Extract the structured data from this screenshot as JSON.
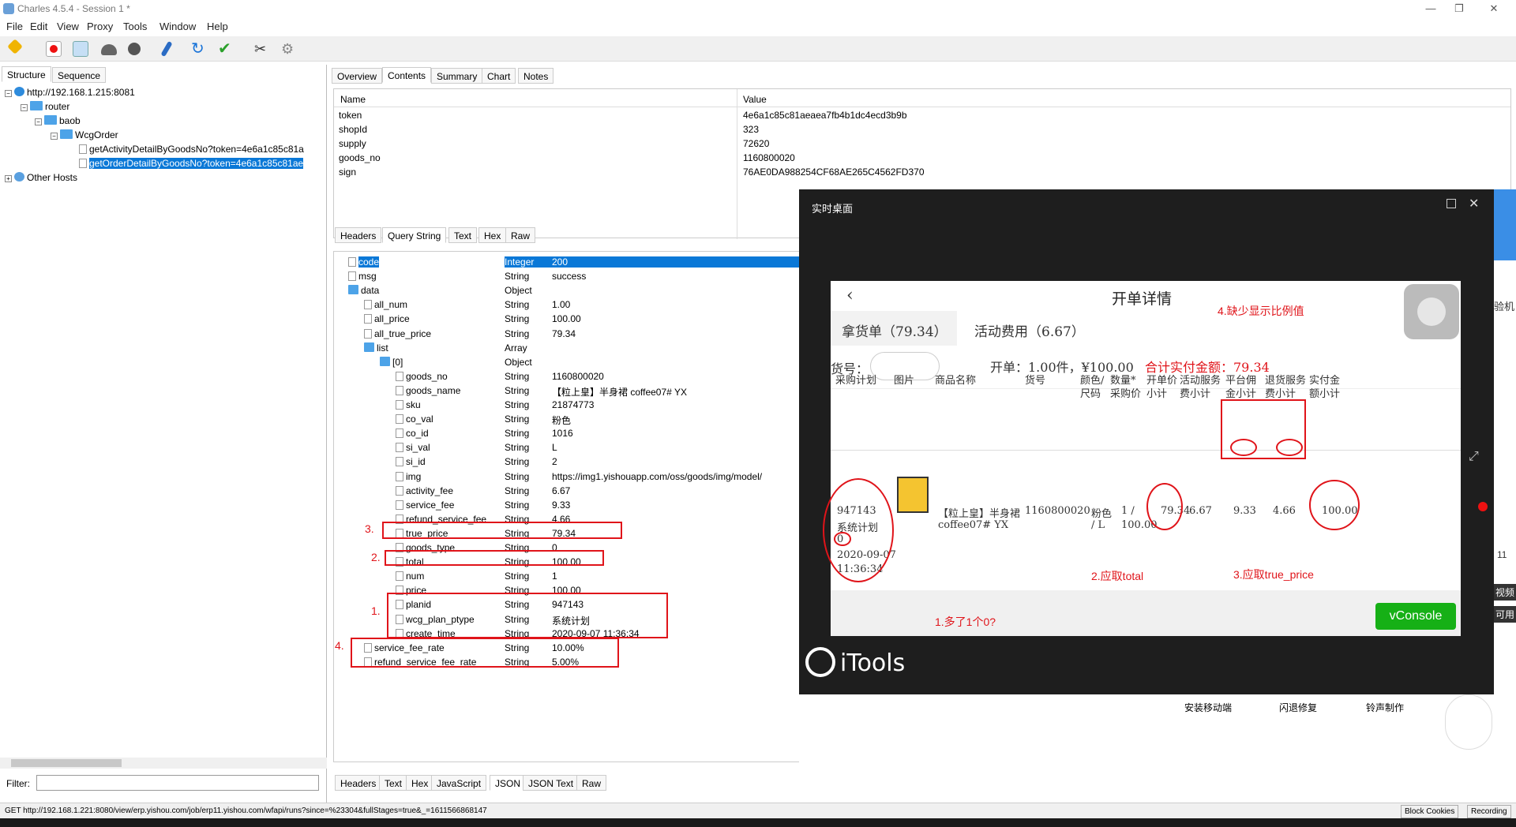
{
  "window": {
    "title": "Charles 4.5.4 - Session 1 *"
  },
  "menu": [
    "File",
    "Edit",
    "View",
    "Proxy",
    "Tools",
    "Window",
    "Help"
  ],
  "left": {
    "tabs": [
      "Structure",
      "Sequence"
    ],
    "tree": {
      "host": "http://192.168.1.215:8081",
      "router": "router",
      "baob": "baob",
      "wcg": "WcgOrder",
      "req1": "getActivityDetailByGoodsNo?token=4e6a1c85c81a",
      "req2": "getOrderDetailByGoodsNo?token=4e6a1c85c81ae",
      "other": "Other Hosts"
    },
    "filter_label": "Filter:"
  },
  "right": {
    "tabs": [
      "Overview",
      "Contents",
      "Summary",
      "Chart",
      "Notes"
    ],
    "table_headers": [
      "Name",
      "Value"
    ],
    "params": [
      {
        "name": "token",
        "value": "4e6a1c85c81aeaea7fb4b1dc4ecd3b9b"
      },
      {
        "name": "shopId",
        "value": "323"
      },
      {
        "name": "supply",
        "value": "72620"
      },
      {
        "name": "goods_no",
        "value": "1160800020"
      },
      {
        "name": "sign",
        "value": "76AE0DA988254CF68AE265C4562FD370"
      }
    ],
    "req_tabs": [
      "Headers",
      "Query String",
      "Text",
      "Hex",
      "Raw"
    ],
    "resp_tabs": [
      "Headers",
      "Text",
      "Hex",
      "JavaScript",
      "JSON",
      "JSON Text",
      "Raw"
    ],
    "json_rows": [
      {
        "k": "code",
        "t": "Integer",
        "v": "200"
      },
      {
        "k": "msg",
        "t": "String",
        "v": "success"
      },
      {
        "k": "data",
        "t": "Object",
        "v": ""
      },
      {
        "k": "all_num",
        "t": "String",
        "v": "1.00"
      },
      {
        "k": "all_price",
        "t": "String",
        "v": "100.00"
      },
      {
        "k": "all_true_price",
        "t": "String",
        "v": "79.34"
      },
      {
        "k": "list",
        "t": "Array",
        "v": ""
      },
      {
        "k": "[0]",
        "t": "Object",
        "v": ""
      },
      {
        "k": "goods_no",
        "t": "String",
        "v": "1160800020"
      },
      {
        "k": "goods_name",
        "t": "String",
        "v": "【粒上皇】半身裙  coffee07#  YX"
      },
      {
        "k": "sku",
        "t": "String",
        "v": "21874773"
      },
      {
        "k": "co_val",
        "t": "String",
        "v": "粉色"
      },
      {
        "k": "co_id",
        "t": "String",
        "v": "1016"
      },
      {
        "k": "si_val",
        "t": "String",
        "v": "L"
      },
      {
        "k": "si_id",
        "t": "String",
        "v": "2"
      },
      {
        "k": "img",
        "t": "String",
        "v": "https://img1.yishouapp.com/oss/goods/img/model/"
      },
      {
        "k": "activity_fee",
        "t": "String",
        "v": "6.67"
      },
      {
        "k": "service_fee",
        "t": "String",
        "v": "9.33"
      },
      {
        "k": "refund_service_fee",
        "t": "String",
        "v": "4.66"
      },
      {
        "k": "true_price",
        "t": "String",
        "v": "79.34"
      },
      {
        "k": "goods_type",
        "t": "String",
        "v": "0"
      },
      {
        "k": "total",
        "t": "String",
        "v": "100.00"
      },
      {
        "k": "num",
        "t": "String",
        "v": "1"
      },
      {
        "k": "price",
        "t": "String",
        "v": "100.00"
      },
      {
        "k": "planid",
        "t": "String",
        "v": "947143"
      },
      {
        "k": "wcg_plan_ptype",
        "t": "String",
        "v": "系统计划"
      },
      {
        "k": "create_time",
        "t": "String",
        "v": "2020-09-07 11:36:34"
      },
      {
        "k": "service_fee_rate",
        "t": "String",
        "v": "10.00%"
      },
      {
        "k": "refund_service_fee_rate",
        "t": "String",
        "v": "5.00%"
      }
    ],
    "annot": [
      "3.",
      "2.",
      "1.",
      "4."
    ]
  },
  "status": {
    "url": "GET http://192.168.1.221:8080/view/erp.yishou.com/job/erp11.yishou.com/wfapi/runs?since=%23304&fullStages=true&_=1611566868147",
    "block": "Block Cookies",
    "rec": "Recording"
  },
  "dialog": {
    "title": "实时桌面",
    "phone": {
      "title": "开单详情",
      "tab1": "拿货单（79.34）",
      "tab2": "活动费用（6.67）",
      "huohao": "货号：",
      "summary": "开单：1.00件，¥100.00",
      "summary_red": "合计实付金额：79.34",
      "cols": [
        "采购计划",
        "图片",
        "商品名称",
        "货号",
        "颜色/尺码",
        "数量*采购价",
        "开单价小计",
        "活动服务费小计",
        "平台佣金小计",
        "退货服务费小计",
        "实付金额小计"
      ],
      "plan": [
        "947143",
        "系统计划",
        "0",
        "2020-09-07",
        "11:36:34"
      ],
      "goods_name": [
        "【粒上皇】半身裙",
        "coffee07# YX"
      ],
      "goods_no": "1160800020",
      "color": [
        "粉色",
        "/ L"
      ],
      "qty": [
        "1 /",
        "100.00"
      ],
      "v_kaidan": "79.34",
      "v_act": "6.67",
      "v_plat": "9.33",
      "v_ret": "4.66",
      "v_real": "100.00",
      "vconsole": "vConsole"
    },
    "notes": [
      "4.缺少显示比例值",
      "2.应取total",
      "3.应取true_price",
      "1.多了1个0?"
    ],
    "itools": "iTools",
    "bottom": [
      "安装移动端",
      "闪退修复",
      "铃声制作"
    ]
  },
  "bg_right": {
    "a": "验机",
    "b": "视频",
    "c": "可用",
    "d": "11"
  }
}
